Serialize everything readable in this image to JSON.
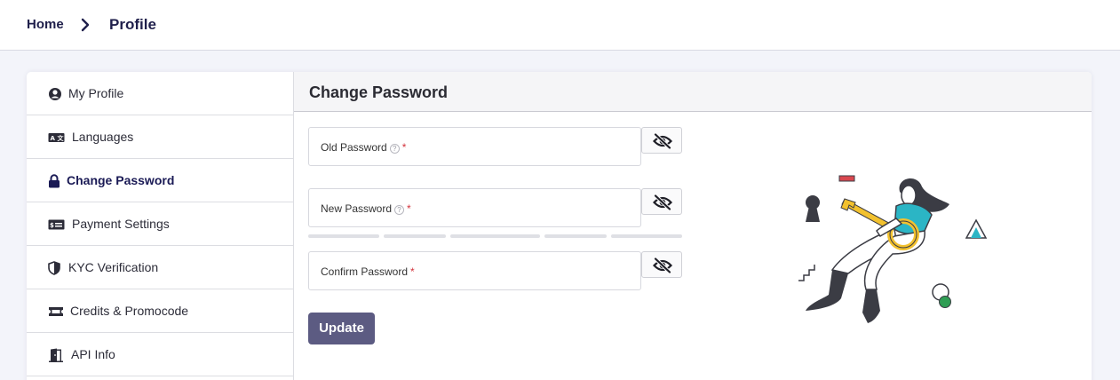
{
  "breadcrumb": {
    "home": "Home",
    "current": "Profile"
  },
  "sidebar": {
    "items": [
      {
        "label": "My Profile",
        "icon": "user-circle-icon",
        "active": false
      },
      {
        "label": "Languages",
        "icon": "translate-icon",
        "active": false
      },
      {
        "label": "Change Password",
        "icon": "lock-icon",
        "active": true
      },
      {
        "label": "Payment Settings",
        "icon": "payment-card-icon",
        "active": false
      },
      {
        "label": "KYC Verification",
        "icon": "shield-icon",
        "active": false
      },
      {
        "label": "Credits & Promocode",
        "icon": "ticket-icon",
        "active": false
      },
      {
        "label": "API Info",
        "icon": "door-icon",
        "active": false
      }
    ]
  },
  "panel": {
    "title": "Change Password",
    "fields": {
      "old_password": {
        "label": "Old Password",
        "required_mark": "*",
        "value": ""
      },
      "new_password": {
        "label": "New Password",
        "required_mark": "*",
        "value": ""
      },
      "confirm_password": {
        "label": "Confirm Password",
        "required_mark": "*",
        "value": ""
      }
    },
    "help_glyph": "?",
    "update_label": "Update"
  },
  "colors": {
    "accent": "#5c5b82",
    "nav_text": "#1f1f4b",
    "required": "#d3323b",
    "illustration_teal": "#2bb5c5",
    "illustration_gold": "#f2c12e"
  }
}
